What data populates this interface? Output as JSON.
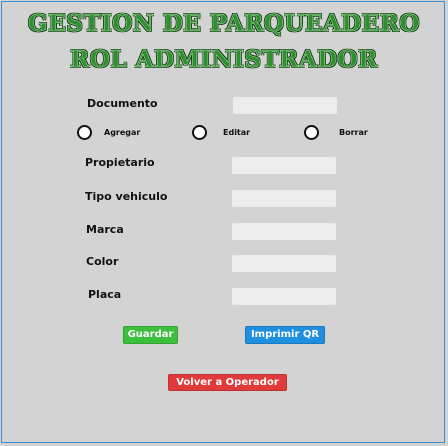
{
  "header": {
    "title_line1": "GESTION DE PARQUEADERO",
    "title_line2": "ROL ADMINISTRADOR"
  },
  "form": {
    "documento_label": "Documento",
    "documento_value": "",
    "radio_agregar": "Agregar",
    "radio_editar": "Editar",
    "radio_borrar": "Borrar",
    "propietario_label": "Propietario",
    "propietario_value": "",
    "tipo_vehiculo_label": "Tipo vehiculo",
    "tipo_vehiculo_value": "",
    "marca_label": "Marca",
    "marca_value": "",
    "color_label": "Color",
    "color_value": "",
    "placa_label": "Placa",
    "placa_value": ""
  },
  "actions": {
    "guardar": "Guardar",
    "imprimir_qr": "Imprimir QR",
    "volver": "Volver a Operador"
  },
  "colors": {
    "background": "#d3d3d3",
    "title_green": "#2f8f2f",
    "guardar_green": "#3cbf3c",
    "imprimir_blue": "#1f8fe0",
    "volver_red": "#e03a3a"
  }
}
